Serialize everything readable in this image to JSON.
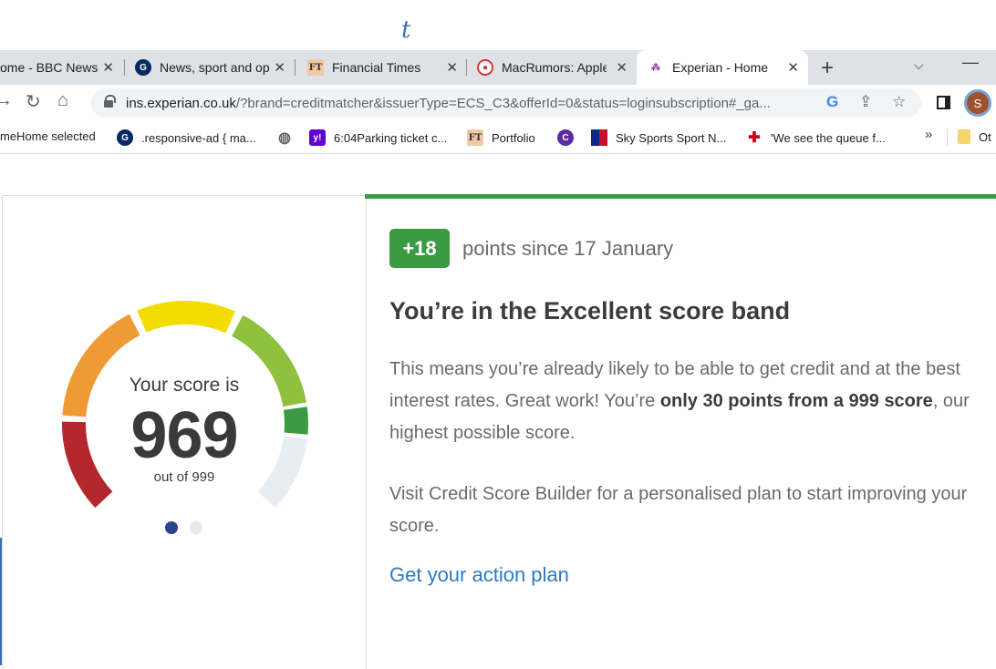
{
  "top": {
    "glyph": "t"
  },
  "tabs": [
    {
      "title": "ome - BBC News",
      "icon": "bbc-icon",
      "active": false
    },
    {
      "title": "News, sport and op",
      "icon": "guardian-icon",
      "active": false
    },
    {
      "title": "Financial Times",
      "icon": "ft-icon",
      "active": false
    },
    {
      "title": "MacRumors: Apple",
      "icon": "macrumors-icon",
      "active": false
    },
    {
      "title": "Experian - Home",
      "icon": "experian-icon",
      "active": true
    }
  ],
  "tabbar": {
    "new_tab": "+",
    "dropdown": "⌵",
    "minimize": "—"
  },
  "toolbar": {
    "url_host": "ins.experian.co.uk",
    "url_rest": "/?brand=creditmatcher&issuerType=ECS_C3&offerId=0&status=loginsubscription#_ga...",
    "google_label": "G",
    "profile_initial": "S"
  },
  "bookmarks": [
    {
      "label": "meHome selected",
      "icon": ""
    },
    {
      "label": ".responsive-ad { ma...",
      "icon": "guardian-icon"
    },
    {
      "label": "",
      "icon": "globe-icon"
    },
    {
      "label": "6:04Parking ticket c...",
      "icon": "yahoo-icon"
    },
    {
      "label": "Portfolio",
      "icon": "ft-icon"
    },
    {
      "label": "",
      "icon": "c-logo-icon"
    },
    {
      "label": "Sky Sports Sport N...",
      "icon": "sky-icon"
    },
    {
      "label": "'We see the queue f...",
      "icon": "red-cross-icon"
    },
    {
      "label": "Ot",
      "icon": "folder-icon"
    }
  ],
  "bookmarks_more": "»",
  "score": {
    "label": "Your score is",
    "value": "969",
    "out_of": "out of 999",
    "fraction": 0.97
  },
  "gauge_colors": {
    "red": "#b3272d",
    "orange": "#ef9a35",
    "yellow": "#f5dc00",
    "light_green": "#8fc13e",
    "green": "#3c9a43",
    "grey": "#e8edf3"
  },
  "points": {
    "badge": "+18",
    "text": "points since 17 January"
  },
  "band": {
    "heading": "You’re in the Excellent score band"
  },
  "para1": {
    "text_a": "This means you’re already likely to be able to get credit and at the best interest rates. Great work! You’re ",
    "bold": "only 30 points from a 999 score",
    "text_b": ", our highest possible score."
  },
  "para2": {
    "text": "Visit Credit Score Builder for a personalised plan to start improving your score."
  },
  "action": {
    "link": "Get your action plan"
  },
  "colors": {
    "accent_green": "#3c9a43",
    "link_blue": "#2c7bc4",
    "dot_active": "#26478d"
  }
}
